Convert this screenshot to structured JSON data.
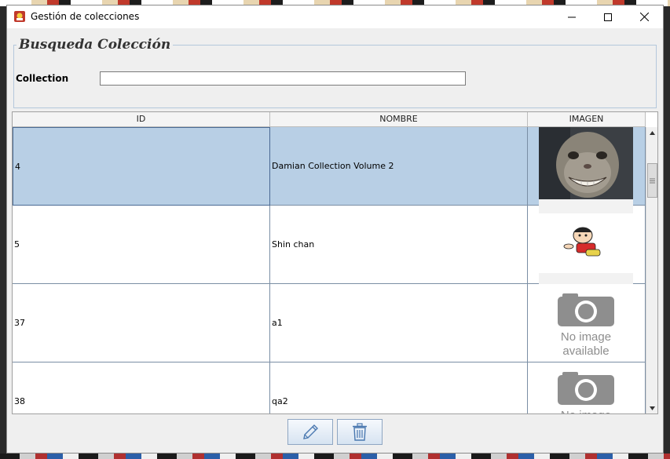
{
  "window": {
    "title": "Gestión de colecciones"
  },
  "search": {
    "title": "Busqueda Colección",
    "collection_label": "Collection",
    "collection_value": "",
    "collection_placeholder": ""
  },
  "table": {
    "columns": [
      "ID",
      "NOMBRE",
      "IMAGEN"
    ],
    "rows": [
      {
        "id": "4",
        "nombre": "Damian Collection Volume 2",
        "image": "cat-photo",
        "selected": true
      },
      {
        "id": "5",
        "nombre": "Shin chan",
        "image": "shin-chan-sticker",
        "selected": false
      },
      {
        "id": "37",
        "nombre": "a1",
        "image": "no-image-available",
        "selected": false
      },
      {
        "id": "38",
        "nombre": "qa2",
        "image": "no-image-available",
        "selected": false
      }
    ],
    "no_image_text_line1": "No image",
    "no_image_text_line2": "available"
  },
  "actions": {
    "edit_icon": "pencil-icon",
    "delete_icon": "trash-icon"
  },
  "colors": {
    "selection": "#b8cfe5",
    "window_bg": "#efefef"
  }
}
